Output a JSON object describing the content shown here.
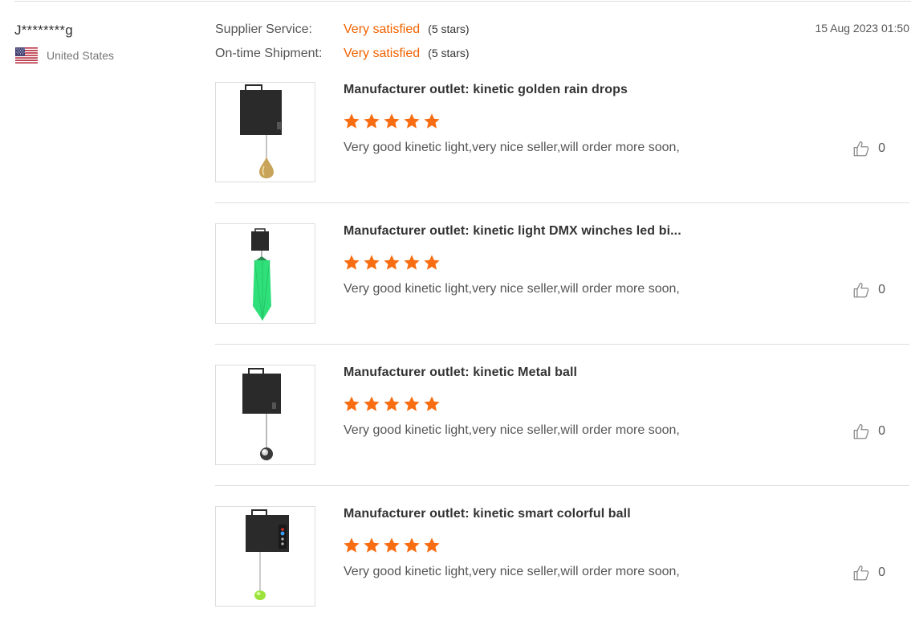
{
  "reviewer": {
    "name": "J********g",
    "country": "United States",
    "flag_icon": "us-flag-icon"
  },
  "ratings": [
    {
      "label": "Supplier Service:",
      "value": "Very satisfied",
      "stars": "(5 stars)"
    },
    {
      "label": "On-time Shipment:",
      "value": "Very satisfied",
      "stars": "(5 stars)"
    }
  ],
  "date": "15 Aug 2023 01:50",
  "colors": {
    "accent": "#f06200",
    "star": "#f96d12",
    "divider": "#dddddd",
    "text": "#333333",
    "muted": "#777777"
  },
  "products": [
    {
      "title": "Manufacturer outlet: kinetic golden rain drops",
      "stars": 5,
      "comment": "Very good kinetic light,very nice seller,will order more soon,",
      "likes": "0",
      "image_icon": "kinetic-golden-raindrop-icon"
    },
    {
      "title": "Manufacturer outlet: kinetic light DMX winches led bi...",
      "stars": 5,
      "comment": "Very good kinetic light,very nice seller,will order more soon,",
      "likes": "0",
      "image_icon": "kinetic-green-crystal-icon"
    },
    {
      "title": "Manufacturer outlet: kinetic Metal ball",
      "stars": 5,
      "comment": "Very good kinetic light,very nice seller,will order more soon,",
      "likes": "0",
      "image_icon": "kinetic-metal-ball-icon"
    },
    {
      "title": "Manufacturer outlet: kinetic smart colorful ball",
      "stars": 5,
      "comment": "Very good kinetic light,very nice seller,will order more soon,",
      "likes": "0",
      "image_icon": "kinetic-colorful-ball-icon"
    }
  ]
}
